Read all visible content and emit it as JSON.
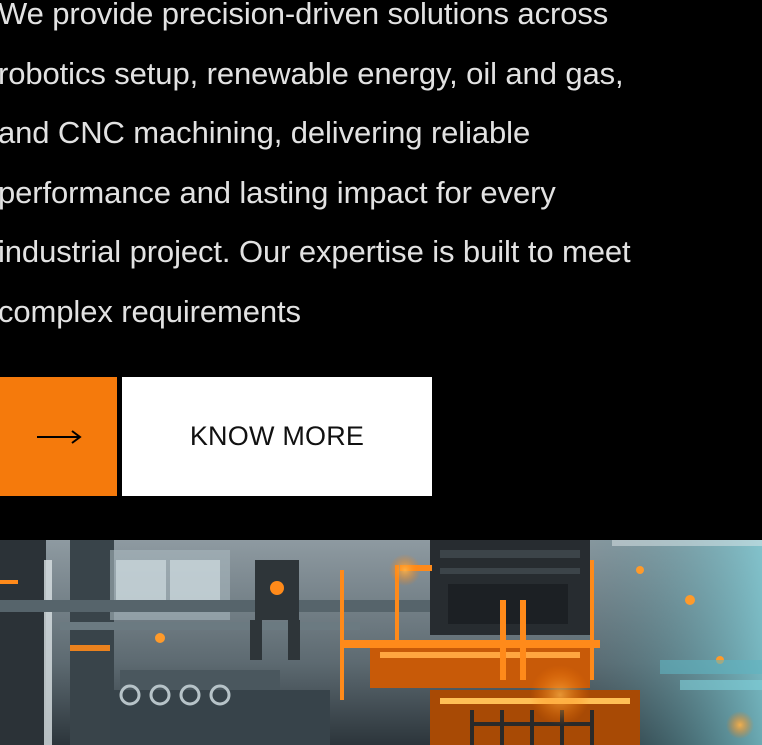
{
  "intro": {
    "paragraph": "We provide precision-driven solutions across\nrobotics setup, renewable energy, oil and gas,\nand CNC machining, delivering reliable\nperformance and lasting impact for every\nindustrial project. Our expertise is built to meet\ncomplex requirements"
  },
  "cta": {
    "arrow_icon": "arrow-right-icon",
    "know_more_label": "KNOW MORE"
  },
  "colors": {
    "background": "#000000",
    "text": "#e2e2e2",
    "accent_orange": "#f57a0c",
    "button_white": "#ffffff"
  }
}
